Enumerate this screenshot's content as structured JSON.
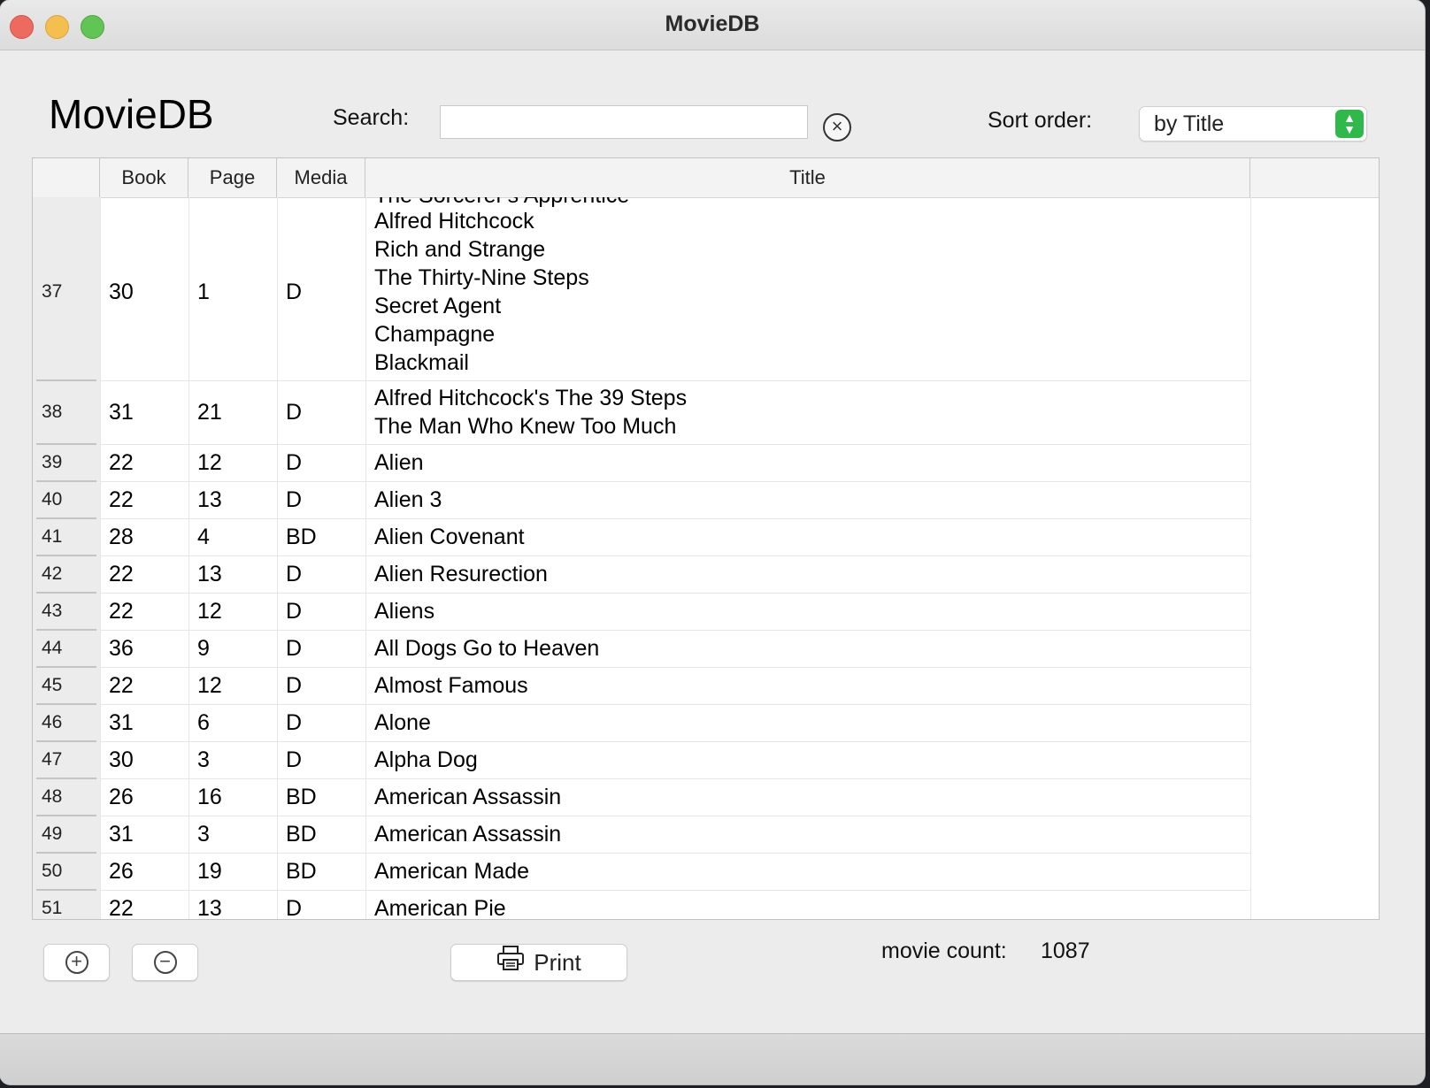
{
  "window": {
    "title": "MovieDB"
  },
  "header": {
    "app_title": "MovieDB",
    "search_label": "Search:",
    "search_value": "",
    "sort_label": "Sort order:",
    "sort_value": "by Title"
  },
  "table": {
    "columns": {
      "book": "Book",
      "page": "Page",
      "media": "Media",
      "title": "Title"
    },
    "partial_top_title": "The Sorcerer's Apprentice",
    "rows": [
      {
        "num": "37",
        "book": "30",
        "page": "1",
        "media": "D",
        "title": "Alfred Hitchcock\nRich and Strange\nThe Thirty-Nine Steps\nSecret Agent\nChampagne\nBlackmail"
      },
      {
        "num": "38",
        "book": "31",
        "page": "21",
        "media": "D",
        "title": "Alfred Hitchcock's The 39 Steps\nThe Man Who Knew Too Much"
      },
      {
        "num": "39",
        "book": "22",
        "page": "12",
        "media": "D",
        "title": "Alien"
      },
      {
        "num": "40",
        "book": "22",
        "page": "13",
        "media": "D",
        "title": "Alien 3"
      },
      {
        "num": "41",
        "book": "28",
        "page": "4",
        "media": "BD",
        "title": "Alien Covenant"
      },
      {
        "num": "42",
        "book": "22",
        "page": "13",
        "media": "D",
        "title": "Alien Resurection"
      },
      {
        "num": "43",
        "book": "22",
        "page": "12",
        "media": "D",
        "title": "Aliens"
      },
      {
        "num": "44",
        "book": "36",
        "page": "9",
        "media": "D",
        "title": "All Dogs Go to Heaven"
      },
      {
        "num": "45",
        "book": "22",
        "page": "12",
        "media": "D",
        "title": "Almost Famous"
      },
      {
        "num": "46",
        "book": "31",
        "page": "6",
        "media": "D",
        "title": "Alone"
      },
      {
        "num": "47",
        "book": "30",
        "page": "3",
        "media": "D",
        "title": "Alpha Dog"
      },
      {
        "num": "48",
        "book": "26",
        "page": "16",
        "media": "BD",
        "title": "American Assassin"
      },
      {
        "num": "49",
        "book": "31",
        "page": "3",
        "media": "BD",
        "title": "American Assassin"
      },
      {
        "num": "50",
        "book": "26",
        "page": "19",
        "media": "BD",
        "title": "American Made"
      },
      {
        "num": "51",
        "book": "22",
        "page": "13",
        "media": "D",
        "title": "American Pie"
      }
    ]
  },
  "footer": {
    "add_icon": "plus-circle-icon",
    "remove_icon": "minus-circle-icon",
    "print_label": "Print",
    "count_label": "movie count:",
    "count_value": "1087"
  }
}
